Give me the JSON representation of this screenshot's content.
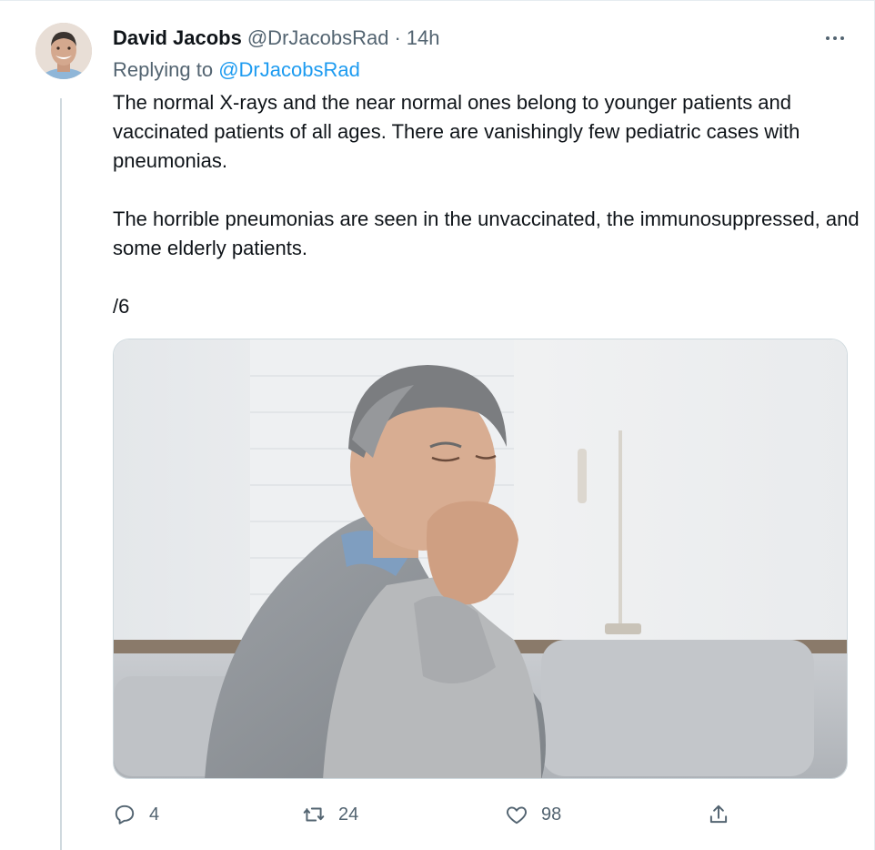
{
  "tweet": {
    "author_name": "David Jacobs",
    "author_handle": "@DrJacobsRad",
    "separator": "·",
    "time": "14h",
    "replying_prefix": "Replying to",
    "replying_handle": "@DrJacobsRad",
    "paragraphs": [
      "The normal X-rays and the near normal ones belong to younger patients and vaccinated patients of all ages. There are vanishingly few pediatric cases with pneumonias.",
      "The horrible pneumonias are seen in the unvaccinated, the immunosuppressed, and some elderly patients.",
      "/6"
    ]
  },
  "actions": {
    "reply_count": "4",
    "retweet_count": "24",
    "like_count": "98"
  },
  "icons": {
    "more": "more-horizontal-icon",
    "reply": "reply-bubble-icon",
    "retweet": "retweet-icon",
    "like": "heart-icon",
    "share": "share-upload-icon"
  },
  "colors": {
    "link": "#1d9bf0",
    "secondary_text": "#536471",
    "primary_text": "#0f1419",
    "thread_line": "#cfd9de"
  }
}
